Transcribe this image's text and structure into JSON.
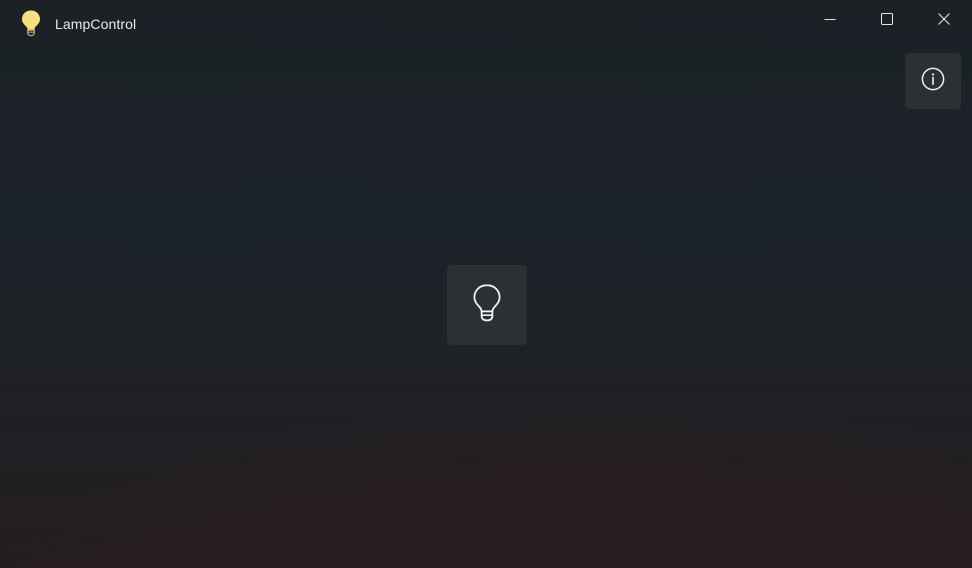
{
  "window": {
    "title": "LampControl",
    "app_icon": "lightbulb-icon",
    "caption_buttons": {
      "minimize_icon": "minimize-icon",
      "maximize_icon": "maximize-icon",
      "close_icon": "close-icon"
    }
  },
  "toolbar": {
    "info_icon": "info-icon"
  },
  "main": {
    "lamp_toggle_icon": "lightbulb-outline-icon",
    "lamp_state": "off"
  },
  "colors": {
    "app_icon_bulb": "#f9dd7e",
    "button_background": "#2b3034",
    "background_top": "#1b2125",
    "background_bottom": "#2b1d1f",
    "text": "#eaeaea"
  }
}
